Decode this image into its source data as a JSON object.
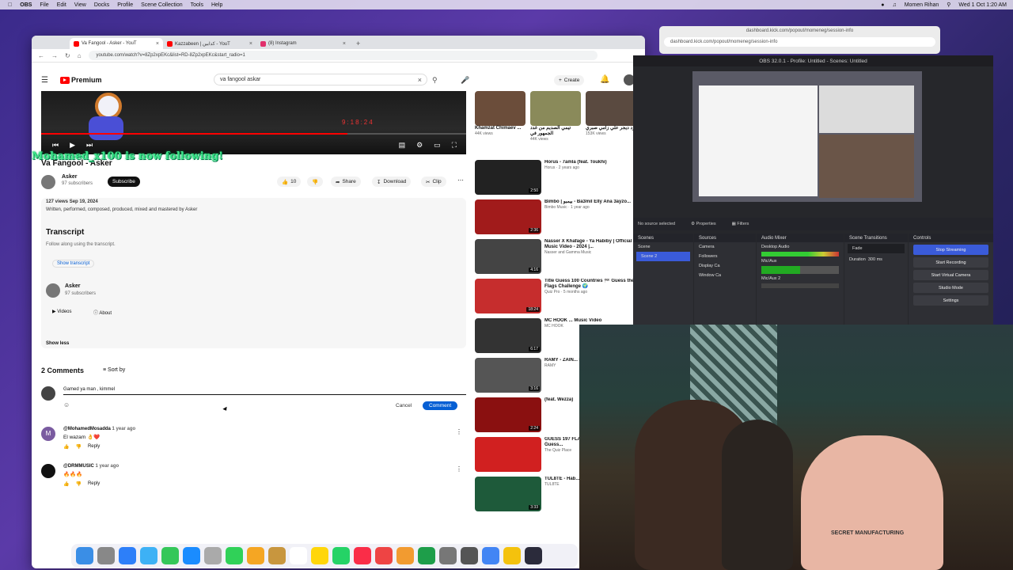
{
  "menubar": {
    "app": "OBS",
    "items": [
      "File",
      "Edit",
      "View",
      "Docks",
      "Profile",
      "Scene Collection",
      "Tools",
      "Help"
    ],
    "user": "Momen Rihan",
    "datetime": "Wed 1 Oct 1:20 AM"
  },
  "browser": {
    "tabs": [
      {
        "label": "Va Fangool - Asker - YouT",
        "active": true,
        "color": "#ff0000"
      },
      {
        "label": "Kazzabeen | كدابين - YouT",
        "active": false,
        "color": "#ff0000"
      },
      {
        "label": "(8) Instagram",
        "active": false,
        "color": "#e1306c"
      }
    ],
    "url": "youtube.com/watch?v=8Zp2xpEKc&list=RD-8Zp2xpEKc&start_radio=1"
  },
  "youtube": {
    "logo_text": "Premium",
    "search_value": "va fangool askar",
    "create_label": "Create",
    "notif_count": "9+",
    "player": {
      "time": "9:18:24",
      "progress": 0.72
    },
    "video_title": "Va Fangool - Asker",
    "channel": {
      "name": "Asker",
      "subs": "97 subscribers"
    },
    "subscribe_label": "Subscribe",
    "like_count": "10",
    "share_label": "Share",
    "download_label": "Download",
    "clip_label": "Clip",
    "follow_overlay": "Mohamed_x100 is now following!",
    "description": {
      "meta": "127 views  Sep 19, 2024",
      "credit": "Written, performed, composed, produced, mixed and mastered by Asker"
    },
    "transcript": {
      "title": "Transcript",
      "subtitle": "Follow along using the transcript.",
      "button": "Show transcript"
    },
    "channel_card": {
      "name": "Asker",
      "subs": "97 subscribers",
      "videos": "Videos",
      "about": "About"
    },
    "show_less": "Show less",
    "comments": {
      "count_label": "2 Comments",
      "sort_label": "Sort by",
      "draft": "Gamed ya man , kimmel",
      "cancel": "Cancel",
      "comment": "Comment",
      "items": [
        {
          "author": "@MohamedMosadda",
          "time": "1 year ago",
          "text": "El wazam 👌❤️",
          "reply": "Reply"
        },
        {
          "author": "@DRMMUSIC",
          "time": "1 year ago",
          "text": "🔥🔥🔥",
          "reply": "Reply"
        }
      ]
    }
  },
  "sidebar": {
    "shorts": [
      {
        "title": "Khamzat Chimaev ...",
        "views": "44K views"
      },
      {
        "title": "تيمي الصديم من غدد الجمهور في",
        "views": "44K views"
      },
      {
        "title": "زد ديجر علي زامي صبري",
        "views": "153K views"
      }
    ],
    "videos": [
      {
        "title": "Horus - 7amla (feat. Toukhi)",
        "meta": "Horus · 2 years ago",
        "dur": "2:50",
        "color": "#222"
      },
      {
        "title": "Bimbo | بيمبو - Ba3mil Elly Ana 3ayzo...",
        "meta": "Bimbo Music · 1 year ago",
        "dur": "2:36",
        "color": "#a11b1b"
      },
      {
        "title": "Nasser X Khafage - Ya Habiby | Official Music Video - 2024 |...",
        "meta": "Nasser and Gamma Music",
        "dur": "4:16",
        "color": "#444"
      },
      {
        "title": "Title Guess 100 Countries 🏁 Guess the Flags Challenge 🌍",
        "meta": "Quiz Pro · 5 months ago",
        "dur": "18:24",
        "color": "#c62d2d"
      },
      {
        "title": "MC HOOK ... Music Video",
        "meta": "MC HOOK",
        "dur": "6:17",
        "color": "#333"
      },
      {
        "title": "RAMY - ZAIN... Music Video",
        "meta": "RAMY",
        "dur": "3:16",
        "color": "#555"
      },
      {
        "title": "(feat. Wezza)",
        "meta": "",
        "dur": "2:24",
        "color": "#8a1010"
      },
      {
        "title": "GUESS 197 FLAGS - Guess All the World! | Guess...",
        "meta": "The Quiz Place",
        "dur": "",
        "color": "#d12020"
      },
      {
        "title": "TUL8TE - Hab...",
        "meta": "TUL8TE",
        "dur": "3:33",
        "color": "#1e5a3a"
      }
    ]
  },
  "kick": {
    "url": "dashboard.kick.com/popout/momeneg/session-info",
    "title": "dashboard.kick.com/popout/momeneg/session-info"
  },
  "obs": {
    "title": "OBS 32.0.1 - Profile: Untitled - Scenes: Untitled",
    "no_source": "No source selected",
    "properties": "Properties",
    "filters": "Filters",
    "docks": {
      "scenes": "Scenes",
      "sources": "Sources",
      "mixer": "Audio Mixer",
      "transitions": "Scene Transitions",
      "controls": "Controls"
    },
    "scene_items": [
      "Scene",
      "Scene 2"
    ],
    "source_items": [
      "Camera",
      "Followers",
      "Display Ca",
      "Window Ca"
    ],
    "mixer_items": [
      "Desktop Audio",
      "Mic/Aux",
      "Mic/Aux 2"
    ],
    "transition": {
      "type": "Fade",
      "duration_label": "Duration",
      "duration": "300 ms"
    },
    "controls": [
      "Stop Streaming",
      "Start Recording",
      "Start Virtual Camera",
      "Studio Mode",
      "Settings"
    ],
    "stop_color": "#3a5bd9"
  },
  "webcam_text": "SECRET MANUFACTURING"
}
